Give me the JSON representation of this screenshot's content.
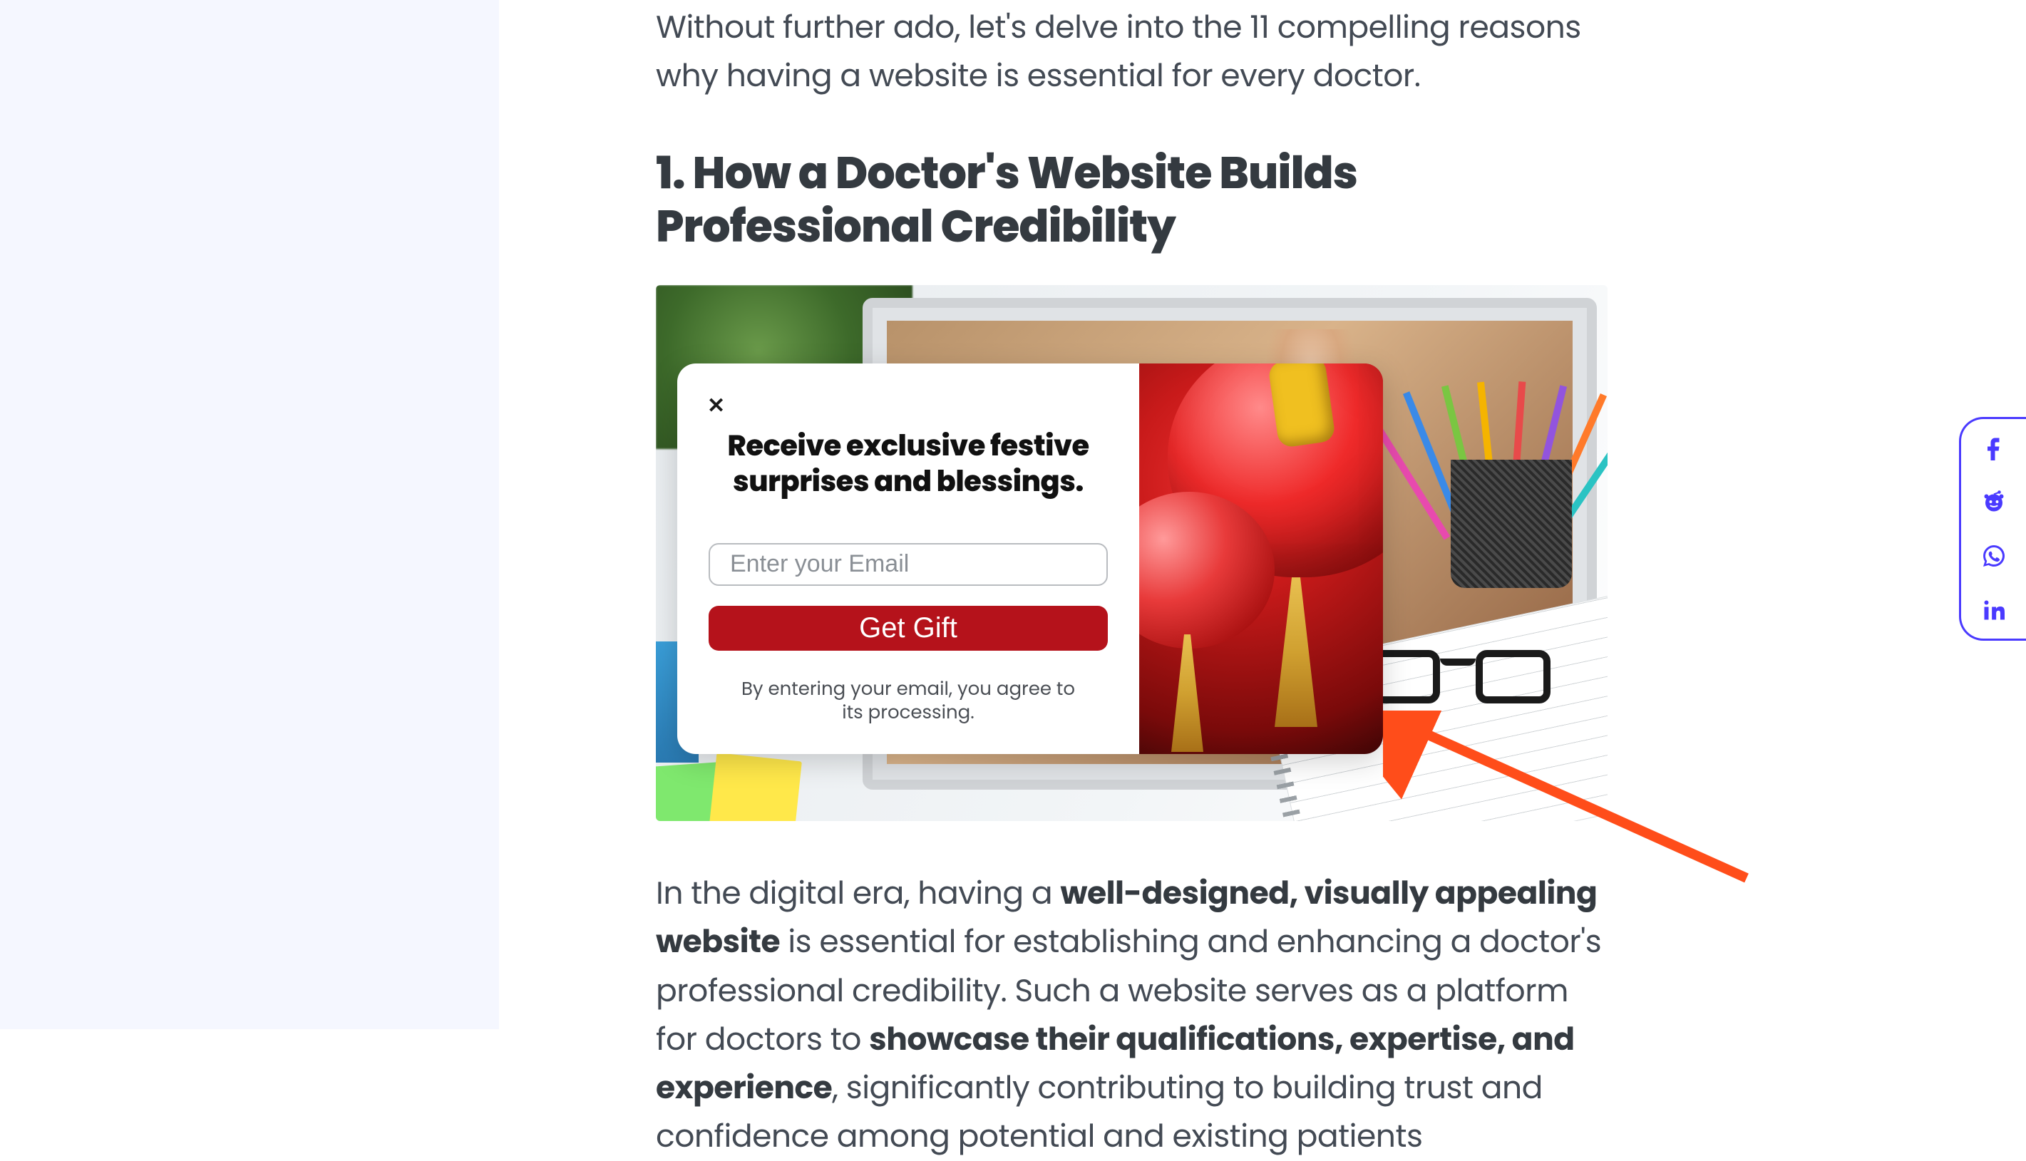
{
  "article": {
    "intro": "Without further ado, let's delve into the 11 compelling reasons why having a website is essential for every doctor.",
    "heading": "1. How a Doctor's Website Builds Professional Credibility",
    "body_prefix": "In the digital era, having a ",
    "body_bold1": "well-designed, visually appealing website",
    "body_mid1": " is essential for establishing and enhancing a doctor's professional credibility. Such a website serves as a platform for doctors to ",
    "body_bold2": "showcase their qualifications, expertise, and experience",
    "body_mid2": ", significantly contributing to building trust and confidence among potential and existing patients"
  },
  "popup": {
    "close": "✕",
    "title": "Receive exclusive festive surprises and blessings.",
    "email_placeholder": "Enter your Email",
    "button": "Get Gift",
    "disclaimer": "By entering your email, you agree to its processing."
  },
  "share": {
    "facebook": "facebook",
    "reddit": "reddit",
    "whatsapp": "whatsapp",
    "linkedin": "linkedin"
  },
  "colors": {
    "accent_purple": "#4a3aff",
    "popup_red": "#b5121b",
    "arrow_orange": "#ff4d1a"
  }
}
